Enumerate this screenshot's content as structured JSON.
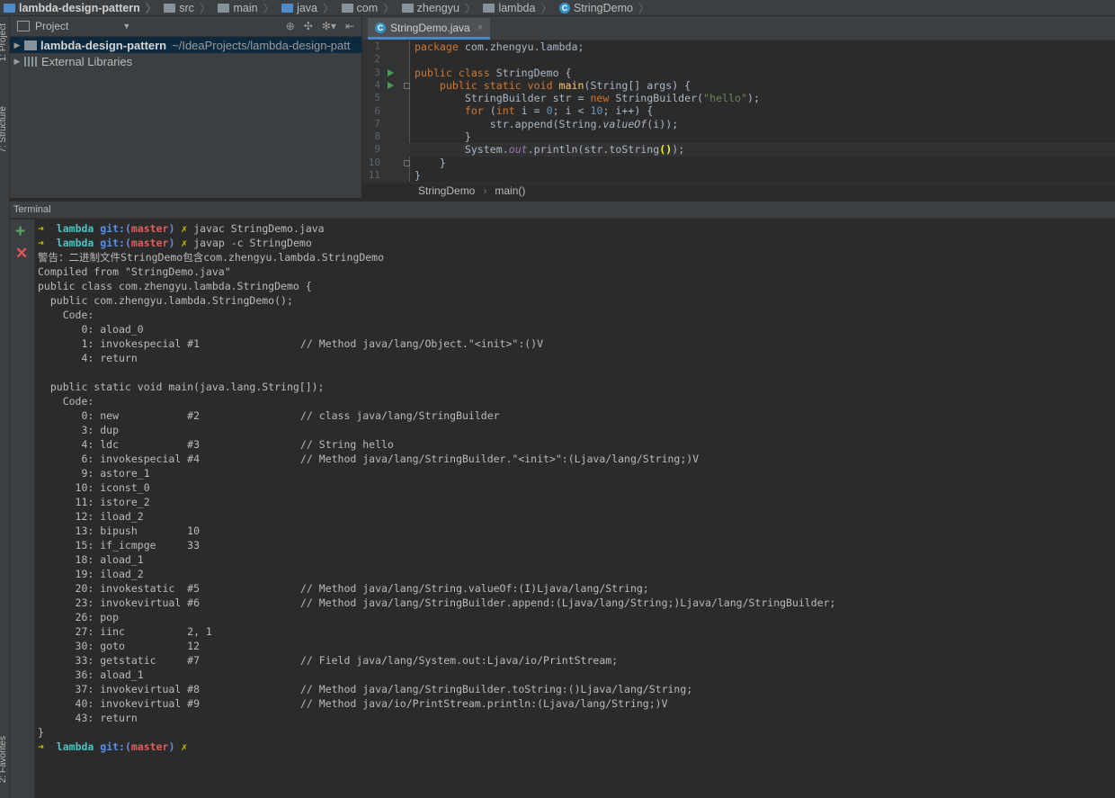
{
  "breadcrumb": [
    "lambda-design-pattern",
    "src",
    "main",
    "java",
    "com",
    "zhengyu",
    "lambda",
    "StringDemo"
  ],
  "left_strip": {
    "project_label": "1: Project",
    "structure_label": "7: Structure",
    "favorites_label": "2: Favorites"
  },
  "project_panel": {
    "title": "Project",
    "project_name": "lambda-design-pattern",
    "project_path": "~/IdeaProjects/lambda-design-patt",
    "external_libraries": "External Libraries"
  },
  "editor": {
    "tab_label": "StringDemo.java",
    "line_numbers": [
      "1",
      "2",
      "3",
      "4",
      "5",
      "6",
      "7",
      "8",
      "9",
      "10",
      "11"
    ],
    "breadcrumb_class": "StringDemo",
    "breadcrumb_method": "main()"
  },
  "code": {
    "l1_kw": "package",
    "l1_rest": " com.zhengyu.lambda;",
    "l3_kw": "public class",
    "l3_rest": " StringDemo {",
    "l4_kw": "public static void",
    "l4_fn": "main",
    "l4_rest": "(String[] args) {",
    "l5_a": "StringBuilder str = ",
    "l5_kw": "new",
    "l5_b": " StringBuilder(",
    "l5_str": "\"hello\"",
    "l5_c": ");",
    "l6_kw": "for",
    "l6_a": " (",
    "l6_kw2": "int",
    "l6_b": " i = ",
    "l6_n1": "0",
    "l6_c": "; i < ",
    "l6_n2": "10",
    "l6_d": "; i++) {",
    "l7_a": "str.append(String.",
    "l7_it": "valueOf",
    "l7_b": "(i));",
    "l8": "}",
    "l9_a": "System.",
    "l9_fld": "out",
    "l9_b": ".println(str.toString",
    "l9_pm": "()",
    "l9_c": ");",
    "l10": "}",
    "l11": "}"
  },
  "terminal": {
    "title": "Terminal",
    "prompt": {
      "arrow": "➜",
      "dir": "lambda",
      "git": "git:(",
      "branch": "master",
      "git_close": ")",
      "dirty": "✗"
    },
    "cmd1": "javac StringDemo.java",
    "cmd2": "javap -c StringDemo",
    "warning": "警告：二进制文件StringDemo包含com.zhengyu.lambda.StringDemo",
    "compiled": "Compiled from \"StringDemo.java\"",
    "class_decl": "public class com.zhengyu.lambda.StringDemo {",
    "ctor_decl": "  public com.zhengyu.lambda.StringDemo();",
    "code_label": "    Code:",
    "ctor_insns": [
      {
        "op": "       0: aload_0",
        "cmt": ""
      },
      {
        "op": "       1: invokespecial #1",
        "cmt": "// Method java/lang/Object.\"<init>\":()V"
      },
      {
        "op": "       4: return",
        "cmt": ""
      }
    ],
    "main_decl": "  public static void main(java.lang.String[]);",
    "main_insns": [
      {
        "op": "       0: new           #2",
        "cmt": "// class java/lang/StringBuilder"
      },
      {
        "op": "       3: dup",
        "cmt": ""
      },
      {
        "op": "       4: ldc           #3",
        "cmt": "// String hello"
      },
      {
        "op": "       6: invokespecial #4",
        "cmt": "// Method java/lang/StringBuilder.\"<init>\":(Ljava/lang/String;)V"
      },
      {
        "op": "       9: astore_1",
        "cmt": ""
      },
      {
        "op": "      10: iconst_0",
        "cmt": ""
      },
      {
        "op": "      11: istore_2",
        "cmt": ""
      },
      {
        "op": "      12: iload_2",
        "cmt": ""
      },
      {
        "op": "      13: bipush        10",
        "cmt": ""
      },
      {
        "op": "      15: if_icmpge     33",
        "cmt": ""
      },
      {
        "op": "      18: aload_1",
        "cmt": ""
      },
      {
        "op": "      19: iload_2",
        "cmt": ""
      },
      {
        "op": "      20: invokestatic  #5",
        "cmt": "// Method java/lang/String.valueOf:(I)Ljava/lang/String;"
      },
      {
        "op": "      23: invokevirtual #6",
        "cmt": "// Method java/lang/StringBuilder.append:(Ljava/lang/String;)Ljava/lang/StringBuilder;"
      },
      {
        "op": "      26: pop",
        "cmt": ""
      },
      {
        "op": "      27: iinc          2, 1",
        "cmt": ""
      },
      {
        "op": "      30: goto          12",
        "cmt": ""
      },
      {
        "op": "      33: getstatic     #7",
        "cmt": "// Field java/lang/System.out:Ljava/io/PrintStream;"
      },
      {
        "op": "      36: aload_1",
        "cmt": ""
      },
      {
        "op": "      37: invokevirtual #8",
        "cmt": "// Method java/lang/StringBuilder.toString:()Ljava/lang/String;"
      },
      {
        "op": "      40: invokevirtual #9",
        "cmt": "// Method java/io/PrintStream.println:(Ljava/lang/String;)V"
      },
      {
        "op": "      43: return",
        "cmt": ""
      }
    ],
    "close_brace": "}"
  }
}
